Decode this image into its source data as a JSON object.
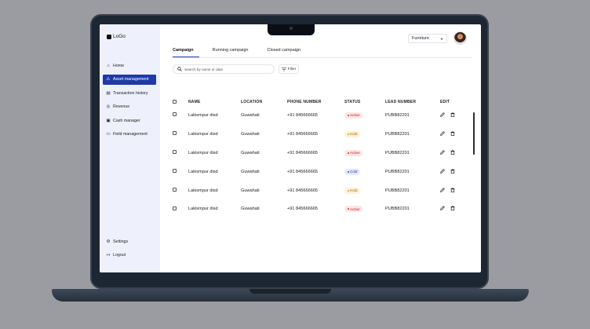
{
  "sidebar": {
    "logo": "LoGo",
    "nav": [
      {
        "label": "Home",
        "icon": "home-icon",
        "glyph": "⌂",
        "active": false
      },
      {
        "label": "Asset management",
        "icon": "warning-icon",
        "glyph": "⚠",
        "active": true
      },
      {
        "label": "Transaction history",
        "icon": "receipt-icon",
        "glyph": "▤",
        "active": false
      },
      {
        "label": "Revenue",
        "icon": "coin-icon",
        "glyph": "◎",
        "active": false
      },
      {
        "label": "Cash manager",
        "icon": "wallet-icon",
        "glyph": "▣",
        "active": false
      },
      {
        "label": "Field management",
        "icon": "folder-icon",
        "glyph": "▭",
        "active": false
      }
    ],
    "bottom": [
      {
        "label": "Settings",
        "icon": "gear-icon",
        "glyph": "⚙"
      },
      {
        "label": "Logout",
        "icon": "logout-icon",
        "glyph": "↦"
      }
    ]
  },
  "header": {
    "category_select": "Furniture"
  },
  "tabs": [
    {
      "label": "Campaign",
      "active": true
    },
    {
      "label": "Running campaign",
      "active": false
    },
    {
      "label": "Closed campaign",
      "active": false
    }
  ],
  "search": {
    "placeholder": "Search by name or date"
  },
  "filter_label": "Filter",
  "table": {
    "columns": [
      "NAME",
      "LOCATION",
      "PHONE NUMBER",
      "STATUS",
      "LEAD NUMBER",
      "EDIT"
    ],
    "rows": [
      {
        "name": "Lakismpur disd",
        "location": "Guwahati",
        "phone": "+91 845666665",
        "status": "Active",
        "lead": "PUBB82201"
      },
      {
        "name": "Lakismpur disd",
        "location": "Guwahati",
        "phone": "+91 845666665",
        "status": "Hold",
        "lead": "PUBB82201"
      },
      {
        "name": "Lakismpur disd",
        "location": "Guwahati",
        "phone": "+91 845666665",
        "status": "Active",
        "lead": "PUBB82201"
      },
      {
        "name": "Lakismpur disd",
        "location": "Guwahati",
        "phone": "+91 845666665",
        "status": "Cold",
        "lead": "PUBB82201"
      },
      {
        "name": "Lakismpur disd",
        "location": "Guwahati",
        "phone": "+91 845666665",
        "status": "Hold",
        "lead": "PUBB82201"
      },
      {
        "name": "Lakismpur disd",
        "location": "Guwahati",
        "phone": "+91 845666665",
        "status": "Active",
        "lead": "PUBB82201"
      }
    ]
  },
  "colors": {
    "accent": "#1f3aa8",
    "sidebar_bg": "#eef1fb",
    "status_active": "#d63333",
    "status_hold": "#e0a020",
    "status_cold": "#3a54c8"
  }
}
